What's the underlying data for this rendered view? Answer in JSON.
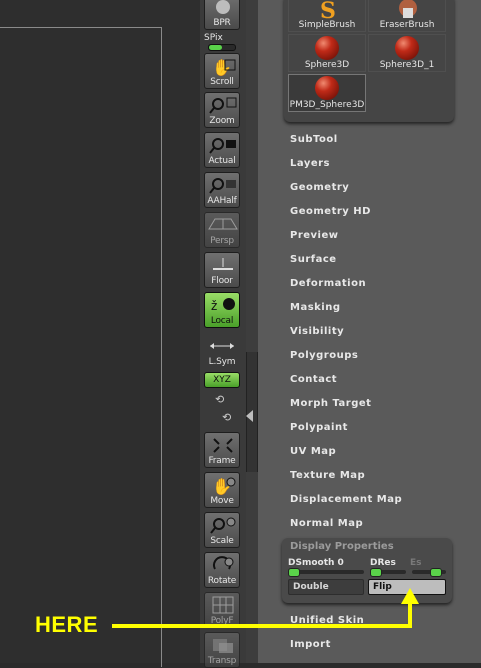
{
  "shelf": {
    "bpr_label": "BPR",
    "spix_label": "SPix",
    "spix_level": 0.5,
    "buttons": [
      {
        "label": "Scroll"
      },
      {
        "label": "Zoom"
      },
      {
        "label": "Actual"
      },
      {
        "label": "AAHalf"
      },
      {
        "label": "Persp"
      },
      {
        "label": "Floor"
      },
      {
        "label": "Local"
      },
      {
        "label": "L.Sym"
      },
      {
        "label": "Frame"
      },
      {
        "label": "Move"
      },
      {
        "label": "Scale"
      },
      {
        "label": "Rotate"
      },
      {
        "label": "PolyF"
      },
      {
        "label": "Transp"
      }
    ],
    "xyz_label": "XYZ"
  },
  "tools": [
    {
      "label": "SimpleBrush"
    },
    {
      "label": "EraserBrush"
    },
    {
      "label": "Sphere3D"
    },
    {
      "label": "Sphere3D_1"
    },
    {
      "label": "PM3D_Sphere3D"
    }
  ],
  "menu": [
    "SubTool",
    "Layers",
    "Geometry",
    "Geometry HD",
    "Preview",
    "Surface",
    "Deformation",
    "Masking",
    "Visibility",
    "Polygroups",
    "Contact",
    "Morph Target",
    "Polypaint",
    "UV Map",
    "Texture Map",
    "Displacement Map",
    "Normal Map"
  ],
  "display_properties": {
    "title": "Display Properties",
    "dsmooth_label": "DSmooth",
    "dsmooth_value": "0",
    "dres_label": "DRes",
    "es_label": "Es",
    "double_label": "Double",
    "flip_label": "Flip"
  },
  "menu_after": [
    "Unified Skin",
    "Import"
  ],
  "annotation": {
    "text": "HERE",
    "color": "#ffff00"
  },
  "colors": {
    "active_green": "#5ad34a"
  }
}
